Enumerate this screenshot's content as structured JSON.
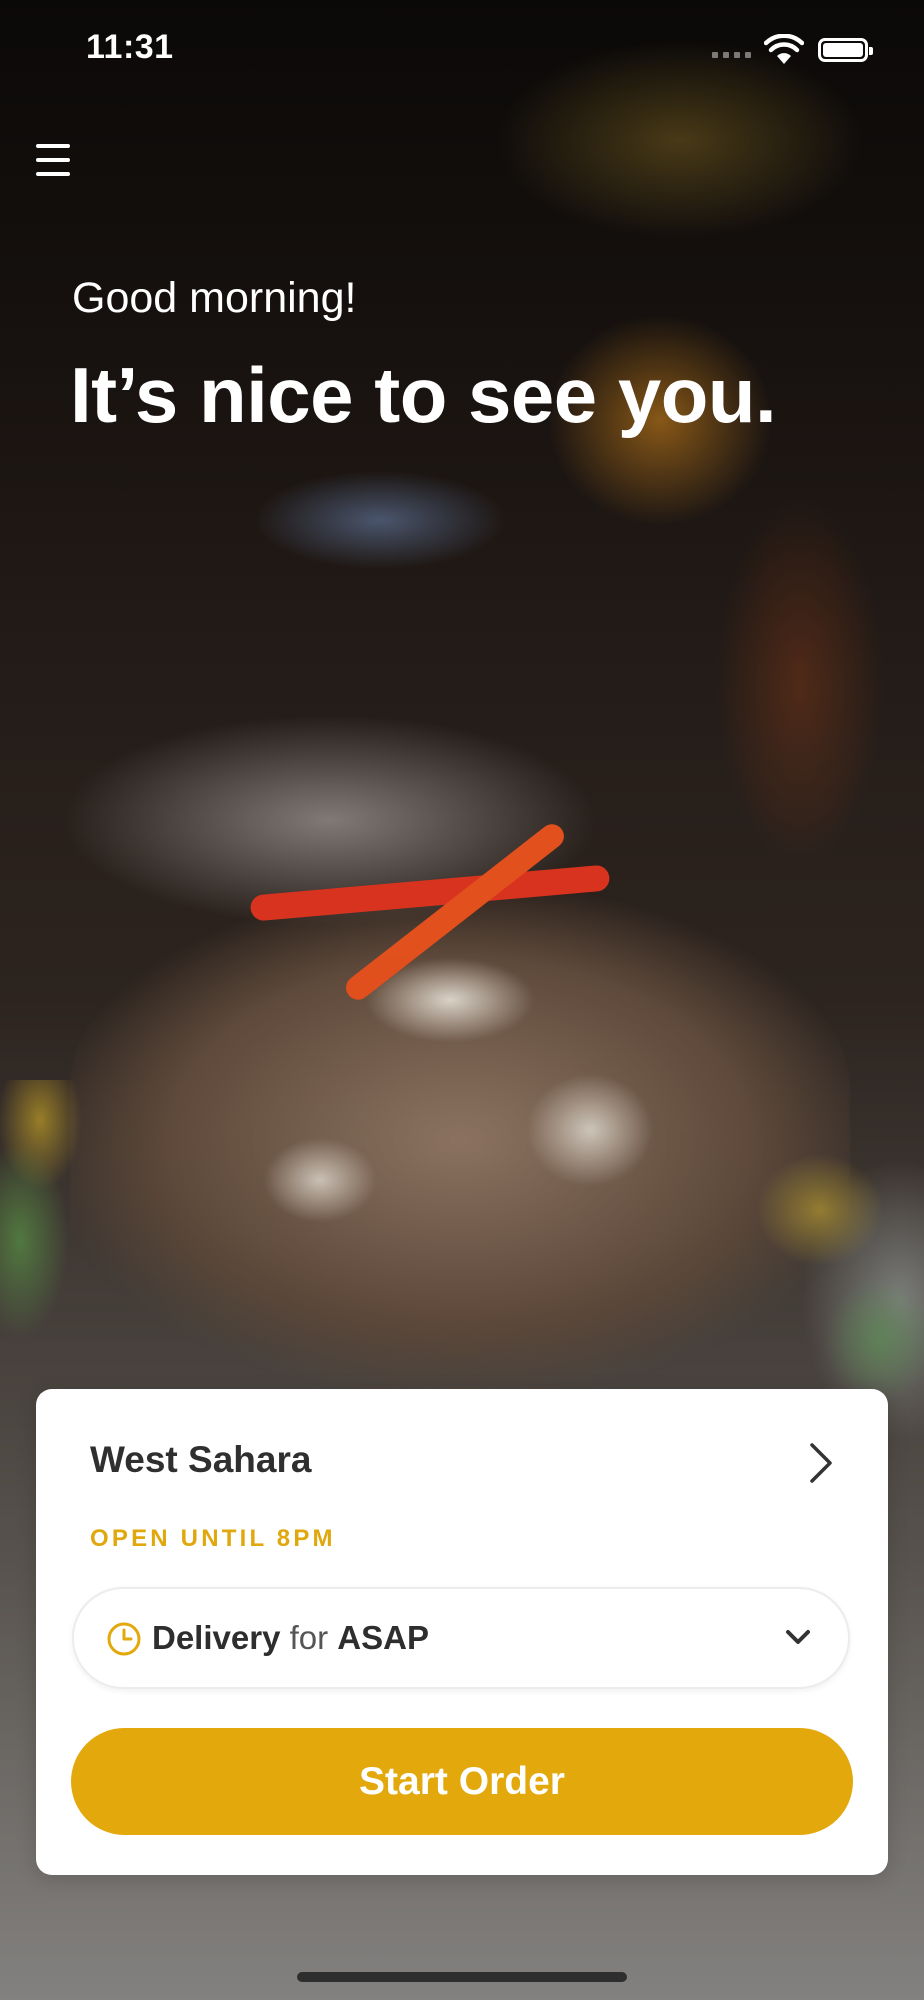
{
  "status_bar": {
    "time": "11:31"
  },
  "greeting": "Good morning!",
  "headline": "It’s nice to see you.",
  "location": {
    "name": "West Sahara",
    "status": "OPEN UNTIL 8PM"
  },
  "order": {
    "method": "Delivery",
    "connector": "for",
    "time": "ASAP"
  },
  "cta": {
    "label": "Start Order"
  },
  "colors": {
    "accent": "#e3a80c",
    "status_text": "#e0a80d",
    "primary_text": "#2f2f2f"
  },
  "icons": [
    "menu-icon",
    "chevron-right-icon",
    "clock-icon",
    "chevron-down-icon",
    "wifi-icon",
    "battery-icon"
  ]
}
